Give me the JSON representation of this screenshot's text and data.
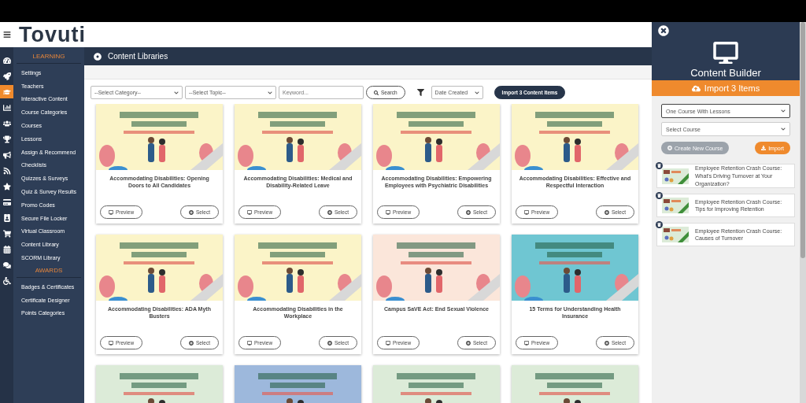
{
  "header": {
    "logo": "Tovuti"
  },
  "icon_rail": [
    {
      "selected": false
    },
    {
      "selected": false
    },
    {
      "selected": true
    },
    {
      "selected": false
    },
    {
      "selected": false
    },
    {
      "selected": false
    },
    {
      "selected": false
    },
    {
      "selected": false
    },
    {
      "selected": false
    },
    {
      "selected": false
    },
    {
      "selected": false
    },
    {
      "selected": false
    },
    {
      "selected": false
    },
    {
      "selected": false
    },
    {
      "selected": false
    }
  ],
  "sidebar": {
    "sections": [
      {
        "heading": "LEARNING",
        "items": [
          "Settings",
          "Teachers",
          "Interactive Content",
          "Course Categories",
          "Courses",
          "Lessons",
          "Assign & Recommend",
          "Checklists",
          "Quizzes & Surveys",
          "Quiz & Survey Results",
          "Promo Codes",
          "Secure File Locker",
          "Virtual Classroom",
          "Content Library",
          "SCORM Library"
        ]
      },
      {
        "heading": "AWARDS",
        "items": [
          "Badges & Certificates",
          "Certificate Designer",
          "Points Categories"
        ]
      }
    ]
  },
  "page_title": "Content Libraries",
  "filters": {
    "category": "--Select Category--",
    "topic": "--Select Topic--",
    "keyword_placeholder": "Keyword...",
    "search": "Search",
    "sort": "Date Created",
    "import_button": "Import 3 Content Items"
  },
  "courses": [
    {
      "title": "Accommodating Disabilities: Opening Doors to All Candidates",
      "color": "#fbf4c8",
      "preview": "Preview",
      "select": "Select"
    },
    {
      "title": "Accommodating Disabilities: Medical and Disability-Related Leave",
      "color": "#fbf4c8",
      "preview": "Preview",
      "select": "Select"
    },
    {
      "title": "Accommodating Disabilities: Empowering Employees with Psychiatric Disabilities",
      "color": "#fbf4c8",
      "preview": "Preview",
      "select": "Select"
    },
    {
      "title": "Accommodating Disabilities: Effective and Respectful Interaction",
      "color": "#fbf4c8",
      "preview": "Preview",
      "select": "Select"
    },
    {
      "title": "Accommodating Disabilities: ADA Myth Busters",
      "color": "#fbf4c8",
      "preview": "Preview",
      "select": "Select"
    },
    {
      "title": "Accommodating Disabilities in the Workplace",
      "color": "#fbf4c8",
      "preview": "Preview",
      "select": "Select"
    },
    {
      "title": "Campus SaVE Act: End Sexual Violence",
      "color": "#fbe6da",
      "preview": "Preview",
      "select": "Select"
    },
    {
      "title": "15 Terms for Understanding Health Insurance",
      "color": "#6fc6d2",
      "preview": "Preview",
      "select": "Select"
    },
    {
      "color": "#dcebd8"
    },
    {
      "color": "#9db8dc"
    },
    {
      "color": "#dcebd8"
    },
    {
      "color": "#dcebd8"
    }
  ],
  "builder": {
    "title": "Content Builder",
    "import_bar": "Import 3 Items",
    "mode_select": "One Course With Lessons",
    "course_select": "Select Course",
    "create_button": {
      "label": "Create New Course",
      "disabled": true
    },
    "import_button": "Import",
    "items": [
      "Employee Retention Crash Course: What's Driving Turnover at Your Organization?",
      "Employee Retention Crash Course: Tips for Improving Retention",
      "Employee Retention Crash Course: Causes of Turnover"
    ]
  }
}
